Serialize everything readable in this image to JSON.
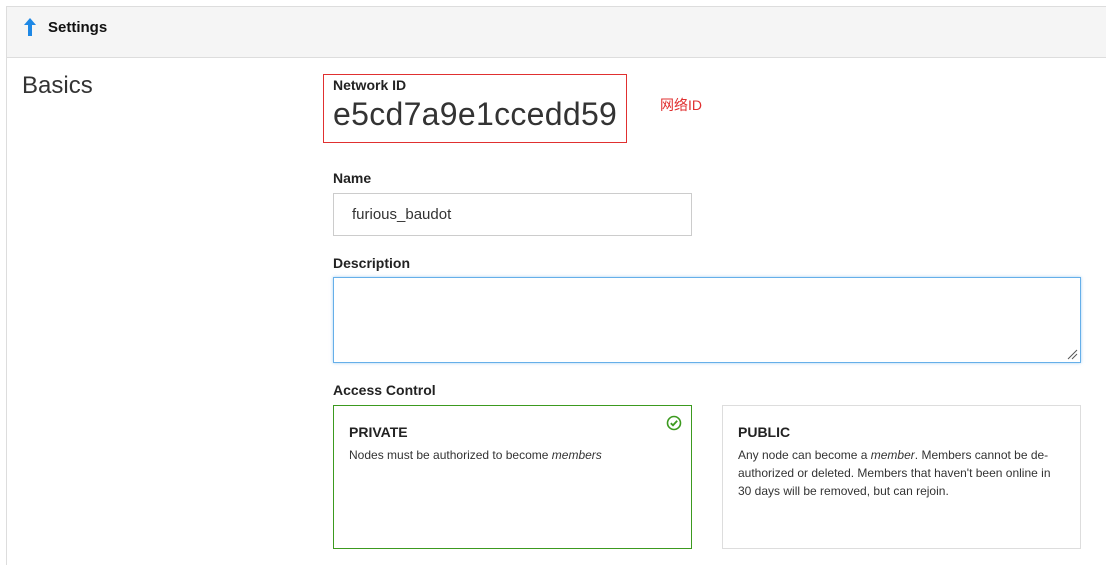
{
  "header": {
    "title": "Settings",
    "icon": "arrow-up-icon",
    "icon_color": "#1e88e5"
  },
  "section": {
    "title": "Basics"
  },
  "network_id": {
    "label": "Network ID",
    "value": "e5cd7a9e1ccedd59",
    "annotation": "网络ID",
    "annotation_color": "#e03030"
  },
  "name": {
    "label": "Name",
    "value": "furious_baudot"
  },
  "description": {
    "label": "Description",
    "value": ""
  },
  "access_control": {
    "label": "Access Control",
    "selected": "PRIVATE",
    "accent_color": "#3c9a1f",
    "options": [
      {
        "title": "PRIVATE",
        "desc_pre": "Nodes must be authorized to become ",
        "desc_em": "members",
        "desc_post": ""
      },
      {
        "title": "PUBLIC",
        "desc_pre": "Any node can become a ",
        "desc_em": "member",
        "desc_post": ". Members cannot be de-authorized or deleted. Members that haven't been online in 30 days will be removed, but can rejoin."
      }
    ]
  }
}
